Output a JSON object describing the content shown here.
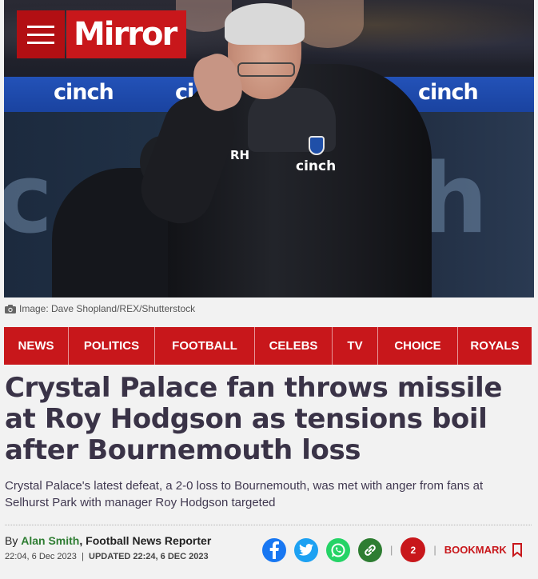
{
  "header": {
    "logo_text": "Mirror",
    "menu_icon": "hamburger-menu-icon",
    "brand_color": "#c8171b"
  },
  "hero": {
    "board_texts": [
      "cinch",
      "ci",
      "cinch"
    ],
    "coat_initials": "RH",
    "coat_sponsor": "cinch",
    "credit_icon": "camera-icon",
    "credit": "Image: Dave Shopland/REX/Shutterstock"
  },
  "nav": {
    "items": [
      {
        "label": "NEWS"
      },
      {
        "label": "POLITICS"
      },
      {
        "label": "FOOTBALL"
      },
      {
        "label": "CELEBS"
      },
      {
        "label": "TV"
      },
      {
        "label": "CHOICE"
      },
      {
        "label": "ROYALS"
      }
    ]
  },
  "article": {
    "headline": "Crystal Palace fan throws missile at Roy Hodgson as tensions boil after Bournemouth loss",
    "standfirst": "Crystal Palace's latest defeat, a 2-0 loss to Bournemouth, was met with anger from fans at Selhurst Park with manager Roy Hodgson targeted",
    "byline_prefix": "By",
    "author": "Alan Smith",
    "author_role": ", Football News Reporter",
    "published": "22:04, 6 Dec 2023",
    "updated": "UPDATED 22:24, 6 DEC 2023"
  },
  "share": {
    "facebook_color": "#1877f2",
    "twitter_color": "#1da1f2",
    "whatsapp_color": "#25d366",
    "link_color": "#2e7d32",
    "separator": "|",
    "comment_count": "2",
    "bookmark_label": "BOOKMARK"
  }
}
